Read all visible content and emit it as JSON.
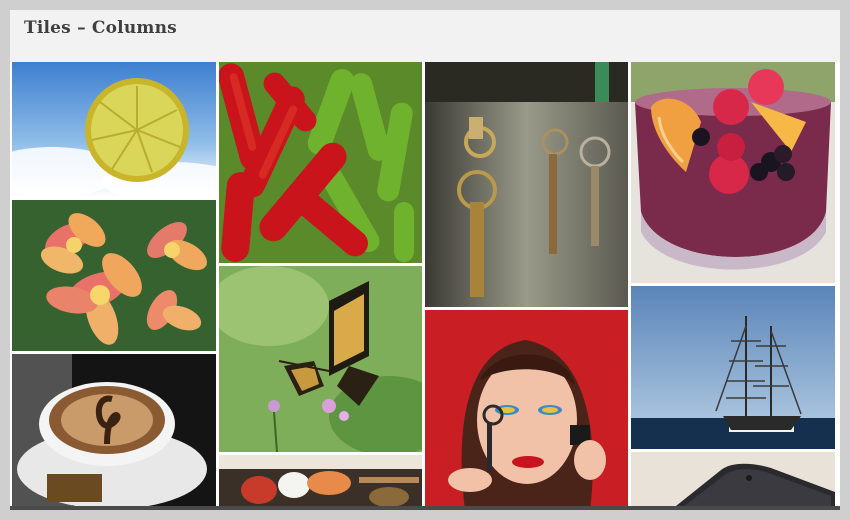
{
  "header": {
    "title": "Tiles – Columns"
  },
  "tiles": [
    {
      "subject": "lemon-slice-sky"
    },
    {
      "subject": "frangipani-flowers"
    },
    {
      "subject": "latte-art-coffee"
    },
    {
      "subject": "red-green-chili-peppers"
    },
    {
      "subject": "swallowtail-butterfly"
    },
    {
      "subject": "sushi-platter"
    },
    {
      "subject": "hanging-keys"
    },
    {
      "subject": "woman-makeup"
    },
    {
      "subject": "fruit-bowl"
    },
    {
      "subject": "tall-ship"
    },
    {
      "subject": "smartphone"
    }
  ]
}
